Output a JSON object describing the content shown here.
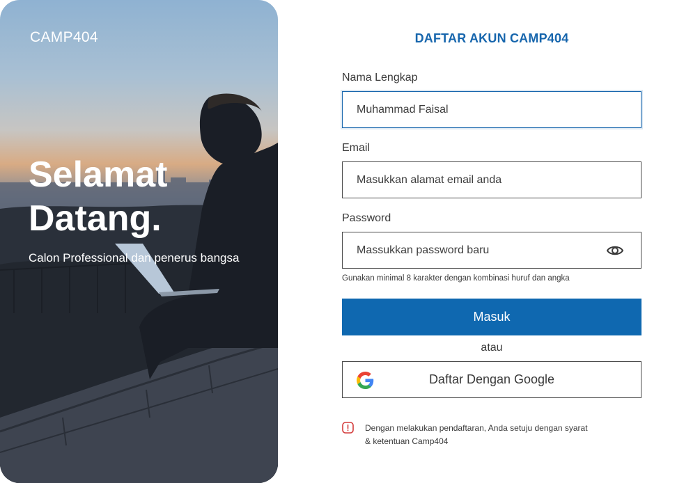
{
  "hero": {
    "brand": "CAMP404",
    "welcome": "Selamat Datang.",
    "tagline": "Calon Professional dan penerus bangsa"
  },
  "form": {
    "title": "DAFTAR AKUN CAMP404",
    "name_label": "Nama Lengkap",
    "name_value": "Muhammad Faisal",
    "email_label": "Email",
    "email_placeholder": "Masukkan alamat email anda",
    "password_label": "Password",
    "password_placeholder": "Massukkan password baru",
    "password_hint": "Gunakan minimal 8 karakter dengan kombinasi huruf dan angka",
    "submit_label": "Masuk",
    "or_text": "atau",
    "google_label": "Daftar Dengan Google",
    "notice_line1": "Dengan melakukan pendaftaran, Anda setuju dengan syarat",
    "notice_line2": "& ketentuan Camp404"
  },
  "icons": {
    "password_toggle": "eye-icon",
    "google": "google-logo-icon",
    "notice": "info-icon"
  },
  "colors": {
    "accent": "#1766ad",
    "button": "#0f68b0",
    "notice_icon": "#d33a3a"
  }
}
